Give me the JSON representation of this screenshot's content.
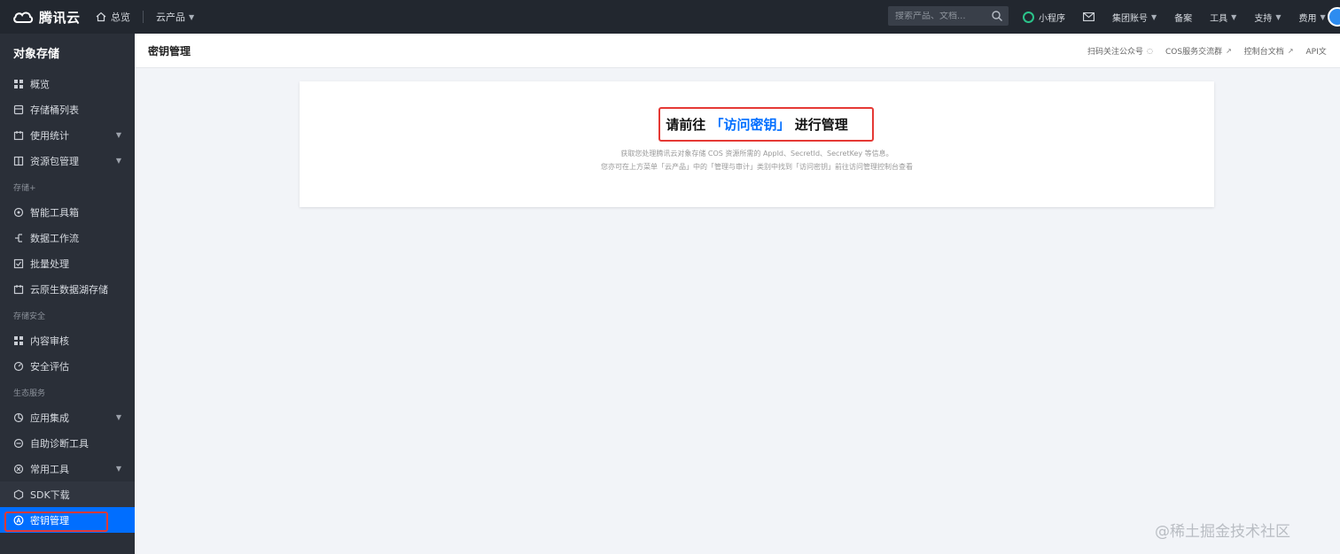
{
  "topbar": {
    "brand": "腾讯云",
    "home": "总览",
    "products": "云产品",
    "search_placeholder": "搜索产品、文档...",
    "mini_program": "小程序",
    "group_account": "集团账号",
    "beian": "备案",
    "tools": "工具",
    "support": "支持",
    "billing": "费用"
  },
  "sidebar": {
    "title": "对象存储",
    "items": [
      {
        "label": "概览"
      },
      {
        "label": "存储桶列表"
      },
      {
        "label": "使用统计"
      },
      {
        "label": "资源包管理"
      }
    ],
    "group_storage_plus": "存储+",
    "storage_plus_items": [
      {
        "label": "智能工具箱"
      },
      {
        "label": "数据工作流"
      },
      {
        "label": "批量处理"
      },
      {
        "label": "云原生数据湖存储"
      }
    ],
    "group_security": "存储安全",
    "security_items": [
      {
        "label": "内容审核"
      },
      {
        "label": "安全评估"
      }
    ],
    "group_ecosystem": "生态服务",
    "ecosystem_items": [
      {
        "label": "应用集成"
      },
      {
        "label": "自助诊断工具"
      },
      {
        "label": "常用工具"
      },
      {
        "label": "SDK下载"
      },
      {
        "label": "密钥管理"
      }
    ]
  },
  "header": {
    "title": "密钥管理",
    "links": [
      "扫码关注公众号",
      "COS服务交流群",
      "控制台文档",
      "API文"
    ]
  },
  "card": {
    "title_prefix": "请前往",
    "title_link": "「访问密钥」",
    "title_suffix": "进行管理",
    "desc1": "获取您处理腾讯云对象存储 COS 资源所需的 AppId、SecretId、SecretKey 等信息。",
    "desc2": "您亦可在上方菜单「云产品」中的「管理与审计」类别中找到「访问密钥」前往访问管理控制台查看"
  },
  "watermark": "@稀土掘金技术社区",
  "colors": {
    "topbar": "#22272f",
    "sidebar": "#2a2f38",
    "active": "#006eff",
    "highlight": "#e53935",
    "link": "#006eff"
  }
}
